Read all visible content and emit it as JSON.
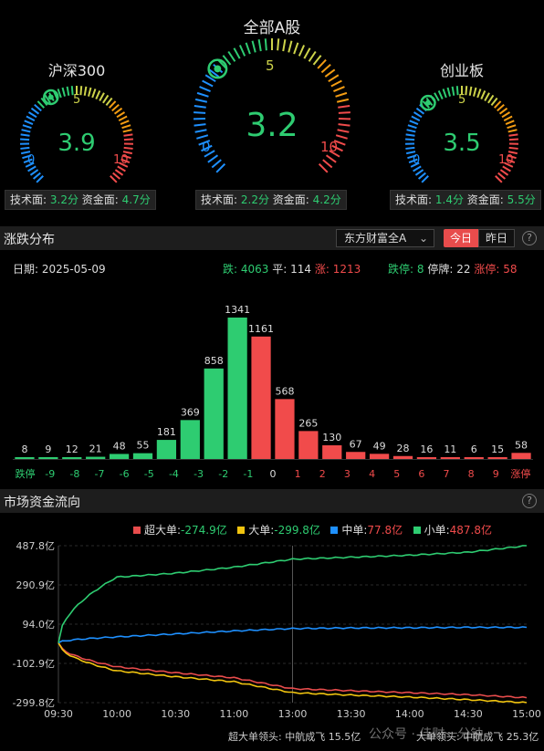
{
  "gauges": {
    "hs300": {
      "title": "沪深300",
      "score": "3.9",
      "value": 3.9,
      "tick_min": "0",
      "tick_mid": "5",
      "tick_max": "10",
      "tech_label": "技术面:",
      "tech_value": "3.2分",
      "fund_label": "资金面:",
      "fund_value": "4.7分"
    },
    "all_a": {
      "title": "全部A股",
      "score": "3.2",
      "value": 3.2,
      "tick_min": "0",
      "tick_mid": "5",
      "tick_max": "10",
      "tech_label": "技术面:",
      "tech_value": "2.2分",
      "fund_label": "资金面:",
      "fund_value": "4.2分"
    },
    "cyb": {
      "title": "创业板",
      "score": "3.5",
      "value": 3.5,
      "tick_min": "0",
      "tick_mid": "5",
      "tick_max": "10",
      "tech_label": "技术面:",
      "tech_value": "1.4分",
      "fund_label": "资金面:",
      "fund_value": "5.5分"
    }
  },
  "distribution": {
    "section_title": "涨跌分布",
    "source_select": "东方财富全A",
    "tab_today": "今日",
    "tab_yesterday": "昨日",
    "help": "?",
    "date_label": "日期:",
    "date": "2025-05-09",
    "fall_label": "跌:",
    "fall_value": "4063",
    "flat_label": "平:",
    "flat_value": "114",
    "rise_label": "涨:",
    "rise_value": "1213",
    "limit_down_label": "跌停:",
    "limit_down_value": "8",
    "halt_label": "停牌:",
    "halt_value": "22",
    "limit_up_label": "涨停:",
    "limit_up_value": "58"
  },
  "flow": {
    "section_title": "市场资金流向",
    "help": "?",
    "legend": [
      {
        "label": "超大单:",
        "value": "-274.9亿",
        "color": "#e84c4c"
      },
      {
        "label": "大单:",
        "value": "-299.8亿",
        "color": "#f1c40f"
      },
      {
        "label": "中单:",
        "value": "77.8亿",
        "color": "#1e90ff"
      },
      {
        "label": "小单:",
        "value": "487.8亿",
        "color": "#2ecc71"
      }
    ],
    "lead_super_label": "超大单领头:",
    "lead_super_value": "中航成飞 15.5亿",
    "lead_big_label": "大单领头:",
    "lead_big_value": "中航成飞 25.3亿",
    "watermark": "公众号 · 佳财一分钟"
  },
  "chart_data": [
    {
      "type": "bar",
      "categories": [
        "跌停",
        "-9",
        "-8",
        "-7",
        "-6",
        "-5",
        "-4",
        "-3",
        "-2",
        "-1",
        "0",
        "1",
        "2",
        "3",
        "4",
        "5",
        "6",
        "7",
        "8",
        "9",
        "涨停"
      ],
      "values": [
        8,
        9,
        12,
        21,
        48,
        55,
        181,
        369,
        858,
        1341,
        1161,
        568,
        265,
        130,
        67,
        49,
        28,
        16,
        11,
        6,
        15,
        58
      ],
      "colors": {
        "down": "#2ecc71",
        "up": "#f14b4b",
        "flat": "#f14b4b"
      }
    },
    {
      "type": "line",
      "x": [
        "09:30",
        "10:00",
        "10:30",
        "11:00",
        "13:00",
        "13:30",
        "14:00",
        "14:30",
        "15:00"
      ],
      "y_ticks": [
        "487.8亿",
        "290.9亿",
        "94.0亿",
        "-102.9亿",
        "-299.8亿"
      ],
      "ylim": [
        -299.8,
        487.8
      ],
      "series": [
        {
          "name": "超大单",
          "color": "#e84c4c",
          "values": [
            0,
            -120,
            -150,
            -175,
            -230,
            -240,
            -250,
            -260,
            -274.9
          ]
        },
        {
          "name": "大单",
          "color": "#f1c40f",
          "values": [
            0,
            -140,
            -170,
            -195,
            -250,
            -262,
            -272,
            -285,
            -299.8
          ]
        },
        {
          "name": "中单",
          "color": "#1e90ff",
          "values": [
            0,
            30,
            45,
            60,
            72,
            75,
            76,
            78,
            77.8
          ]
        },
        {
          "name": "小单",
          "color": "#2ecc71",
          "values": [
            0,
            330,
            350,
            380,
            420,
            430,
            440,
            455,
            487.8
          ]
        }
      ]
    }
  ]
}
